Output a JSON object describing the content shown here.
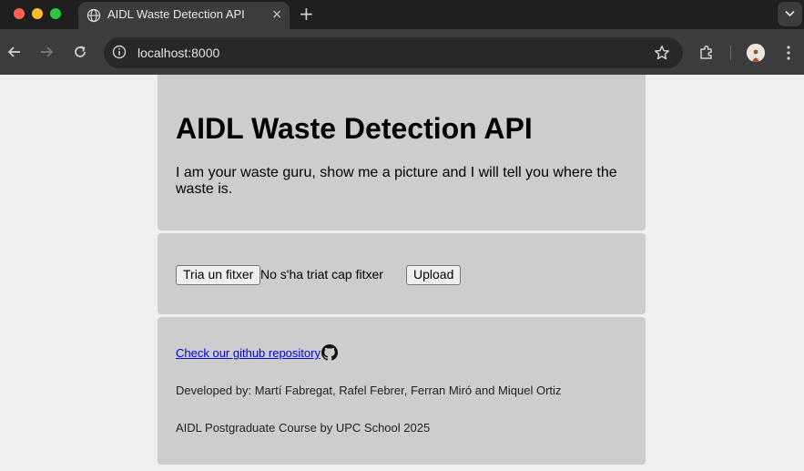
{
  "browser": {
    "tab_title": "AIDL Waste Detection API",
    "tab_close": "×",
    "new_tab": "+",
    "url": "localhost:8000"
  },
  "icons": {
    "tab": "globe-icon",
    "back": "arrow-left-icon",
    "forward": "arrow-right-icon",
    "reload": "reload-icon",
    "site_info": "info-icon",
    "bookmark": "star-icon",
    "extensions": "puzzle-icon",
    "profile": "avatar",
    "menu": "kebab-menu-icon",
    "tab_search": "chevron-down-icon",
    "repo": "github-icon"
  },
  "page": {
    "title": "AIDL Waste Detection API",
    "intro": "I am your waste guru, show me a picture and I will tell you where the waste is.",
    "file_button": "Tria un fitxer",
    "file_status": "No s'ha triat cap fitxer",
    "upload_button": "Upload",
    "github_link": "Check our github repository",
    "credits": "Developed by: Martí Fabregat, Rafel Febrer, Ferran Miró and Miquel Ortiz",
    "course": "AIDL Postgraduate Course by UPC School 2025"
  }
}
